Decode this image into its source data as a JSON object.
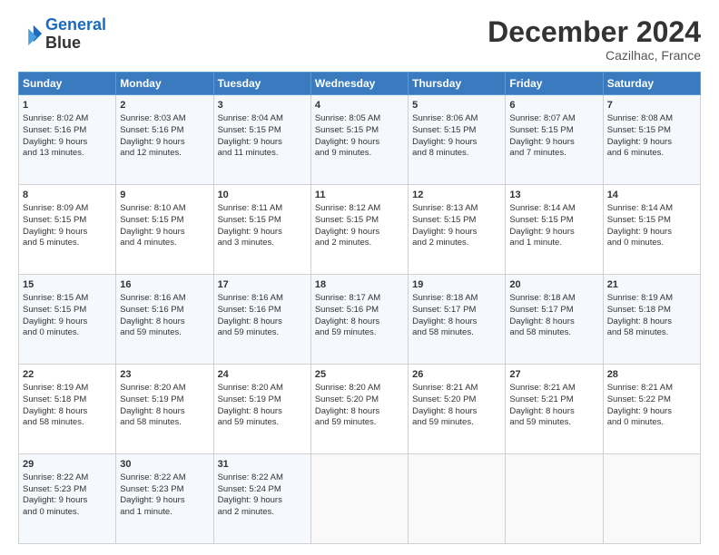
{
  "header": {
    "logo_line1": "General",
    "logo_line2": "Blue",
    "month_title": "December 2024",
    "location": "Cazilhac, France"
  },
  "days_of_week": [
    "Sunday",
    "Monday",
    "Tuesday",
    "Wednesday",
    "Thursday",
    "Friday",
    "Saturday"
  ],
  "weeks": [
    [
      {
        "day": 1,
        "info": [
          "Sunrise: 8:02 AM",
          "Sunset: 5:16 PM",
          "Daylight: 9 hours",
          "and 13 minutes."
        ]
      },
      {
        "day": 2,
        "info": [
          "Sunrise: 8:03 AM",
          "Sunset: 5:16 PM",
          "Daylight: 9 hours",
          "and 12 minutes."
        ]
      },
      {
        "day": 3,
        "info": [
          "Sunrise: 8:04 AM",
          "Sunset: 5:15 PM",
          "Daylight: 9 hours",
          "and 11 minutes."
        ]
      },
      {
        "day": 4,
        "info": [
          "Sunrise: 8:05 AM",
          "Sunset: 5:15 PM",
          "Daylight: 9 hours",
          "and 9 minutes."
        ]
      },
      {
        "day": 5,
        "info": [
          "Sunrise: 8:06 AM",
          "Sunset: 5:15 PM",
          "Daylight: 9 hours",
          "and 8 minutes."
        ]
      },
      {
        "day": 6,
        "info": [
          "Sunrise: 8:07 AM",
          "Sunset: 5:15 PM",
          "Daylight: 9 hours",
          "and 7 minutes."
        ]
      },
      {
        "day": 7,
        "info": [
          "Sunrise: 8:08 AM",
          "Sunset: 5:15 PM",
          "Daylight: 9 hours",
          "and 6 minutes."
        ]
      }
    ],
    [
      {
        "day": 8,
        "info": [
          "Sunrise: 8:09 AM",
          "Sunset: 5:15 PM",
          "Daylight: 9 hours",
          "and 5 minutes."
        ]
      },
      {
        "day": 9,
        "info": [
          "Sunrise: 8:10 AM",
          "Sunset: 5:15 PM",
          "Daylight: 9 hours",
          "and 4 minutes."
        ]
      },
      {
        "day": 10,
        "info": [
          "Sunrise: 8:11 AM",
          "Sunset: 5:15 PM",
          "Daylight: 9 hours",
          "and 3 minutes."
        ]
      },
      {
        "day": 11,
        "info": [
          "Sunrise: 8:12 AM",
          "Sunset: 5:15 PM",
          "Daylight: 9 hours",
          "and 2 minutes."
        ]
      },
      {
        "day": 12,
        "info": [
          "Sunrise: 8:13 AM",
          "Sunset: 5:15 PM",
          "Daylight: 9 hours",
          "and 2 minutes."
        ]
      },
      {
        "day": 13,
        "info": [
          "Sunrise: 8:14 AM",
          "Sunset: 5:15 PM",
          "Daylight: 9 hours",
          "and 1 minute."
        ]
      },
      {
        "day": 14,
        "info": [
          "Sunrise: 8:14 AM",
          "Sunset: 5:15 PM",
          "Daylight: 9 hours",
          "and 0 minutes."
        ]
      }
    ],
    [
      {
        "day": 15,
        "info": [
          "Sunrise: 8:15 AM",
          "Sunset: 5:15 PM",
          "Daylight: 9 hours",
          "and 0 minutes."
        ]
      },
      {
        "day": 16,
        "info": [
          "Sunrise: 8:16 AM",
          "Sunset: 5:16 PM",
          "Daylight: 8 hours",
          "and 59 minutes."
        ]
      },
      {
        "day": 17,
        "info": [
          "Sunrise: 8:16 AM",
          "Sunset: 5:16 PM",
          "Daylight: 8 hours",
          "and 59 minutes."
        ]
      },
      {
        "day": 18,
        "info": [
          "Sunrise: 8:17 AM",
          "Sunset: 5:16 PM",
          "Daylight: 8 hours",
          "and 59 minutes."
        ]
      },
      {
        "day": 19,
        "info": [
          "Sunrise: 8:18 AM",
          "Sunset: 5:17 PM",
          "Daylight: 8 hours",
          "and 58 minutes."
        ]
      },
      {
        "day": 20,
        "info": [
          "Sunrise: 8:18 AM",
          "Sunset: 5:17 PM",
          "Daylight: 8 hours",
          "and 58 minutes."
        ]
      },
      {
        "day": 21,
        "info": [
          "Sunrise: 8:19 AM",
          "Sunset: 5:18 PM",
          "Daylight: 8 hours",
          "and 58 minutes."
        ]
      }
    ],
    [
      {
        "day": 22,
        "info": [
          "Sunrise: 8:19 AM",
          "Sunset: 5:18 PM",
          "Daylight: 8 hours",
          "and 58 minutes."
        ]
      },
      {
        "day": 23,
        "info": [
          "Sunrise: 8:20 AM",
          "Sunset: 5:19 PM",
          "Daylight: 8 hours",
          "and 58 minutes."
        ]
      },
      {
        "day": 24,
        "info": [
          "Sunrise: 8:20 AM",
          "Sunset: 5:19 PM",
          "Daylight: 8 hours",
          "and 59 minutes."
        ]
      },
      {
        "day": 25,
        "info": [
          "Sunrise: 8:20 AM",
          "Sunset: 5:20 PM",
          "Daylight: 8 hours",
          "and 59 minutes."
        ]
      },
      {
        "day": 26,
        "info": [
          "Sunrise: 8:21 AM",
          "Sunset: 5:20 PM",
          "Daylight: 8 hours",
          "and 59 minutes."
        ]
      },
      {
        "day": 27,
        "info": [
          "Sunrise: 8:21 AM",
          "Sunset: 5:21 PM",
          "Daylight: 8 hours",
          "and 59 minutes."
        ]
      },
      {
        "day": 28,
        "info": [
          "Sunrise: 8:21 AM",
          "Sunset: 5:22 PM",
          "Daylight: 9 hours",
          "and 0 minutes."
        ]
      }
    ],
    [
      {
        "day": 29,
        "info": [
          "Sunrise: 8:22 AM",
          "Sunset: 5:23 PM",
          "Daylight: 9 hours",
          "and 0 minutes."
        ]
      },
      {
        "day": 30,
        "info": [
          "Sunrise: 8:22 AM",
          "Sunset: 5:23 PM",
          "Daylight: 9 hours",
          "and 1 minute."
        ]
      },
      {
        "day": 31,
        "info": [
          "Sunrise: 8:22 AM",
          "Sunset: 5:24 PM",
          "Daylight: 9 hours",
          "and 2 minutes."
        ]
      },
      null,
      null,
      null,
      null
    ]
  ]
}
